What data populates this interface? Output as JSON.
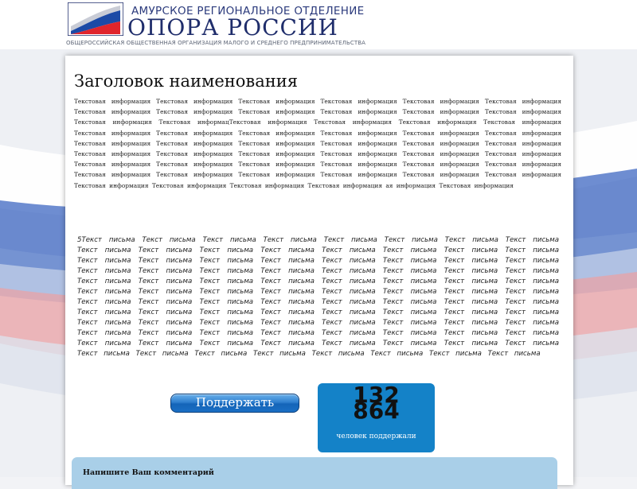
{
  "header": {
    "region": "АМУРСКОЕ РЕГИОНАЛЬНОЕ ОТДЕЛЕНИЕ",
    "org_name": "ОПОРА РОССИИ",
    "subtitle": "ОБЩЕРОССИЙСКАЯ ОБЩЕСТВЕННАЯ ОРГАНИЗАЦИЯ МАЛОГО И СРЕДНЕГО ПРЕДПРИНИМАТЕЛЬСТВА",
    "logo_icon": "russian-flag-logo-icon",
    "flag_colors": [
      "#ffffff",
      "#1c4aa6",
      "#e0252c"
    ]
  },
  "content": {
    "title": "Заголовок наименования",
    "body_text": "Текстовая информация Текстовая информация Текстовая информация Текстовая информация Текстовая информация Текстовая информация Текстовая информация Текстовая информация Текстовая информация Текстовая информация Текстовая информация Текстовая информация Текстовая информация Текстовая информацТекстовая информация Текстовая информация Текстовая информация Текстовая информация Текстовая информация Текстовая информация Текстовая информация Текстовая информация Текстовая информация Текстовая информация Текстовая информация Текстовая информация Текстовая информация Текстовая информация Текстовая информация Текстовая информация Текстовая информация Текстовая информация Текстовая информация Текстовая информация Текстовая информация Текстовая информация Текстовая информация Текстовая информация Текстовая информация Текстовая информация Текстовая информация Текстовая информация Текстовая информация Текстовая информация Текстовая информация Текстовая информация Текстовая информация Текстовая информация Текстовая информация Текстовая информация Текстовая информация Текстовая информация ая информация Текстовая информация",
    "letter_text": "5Текст письма Текст письма Текст письма Текст письма Текст письма Текст письма Текст письма Текст письма Текст письма Текст письма Текст письма Текст письма Текст письма Текст письма Текст письма Текст письма Текст письма Текст письма Текст письма Текст письма Текст письма Текст письма Текст письма Текст письма Текст письма Текст письма Текст письма Текст письма Текст письма Текст письма Текст письма Текст письма Текст письма Текст письма Текст письма Текст письма Текст письма Текст письма Текст письма Текст письма Текст письма Текст письма Текст письма Текст письма Текст письма Текст письма Текст письма Текст письма Текст письма Текст письма Текст письма Текст письма Текст письма Текст письма Текст письма Текст письма Текст письма Текст письма Текст письма Текст письма Текст письма Текст письма Текст письма Текст письма Текст письма Текст письма Текст письма Текст письма Текст письма Текст письма Текст письма Текст письма Текст письма Текст письма Текст письма Текст письма Текст письма Текст письма Текст письма Текст письма Текст письма Текст письма Текст письма Текст письма Текст письма Текст письма Текст письма Текст письма Текст письма Текст письма Текст письма Текст письма Текст письма Текст письма Текст письма Текст письма"
  },
  "support": {
    "button_label": "Поддержать",
    "button_color": "#1a6fc4"
  },
  "counter": {
    "count_line1": "132",
    "count_line2": "864",
    "label": "человек поддержали",
    "color": "#1482c8"
  },
  "comments": {
    "heading": "Напишите Ваш комментарий",
    "panel_color": "#a9cfe8"
  }
}
